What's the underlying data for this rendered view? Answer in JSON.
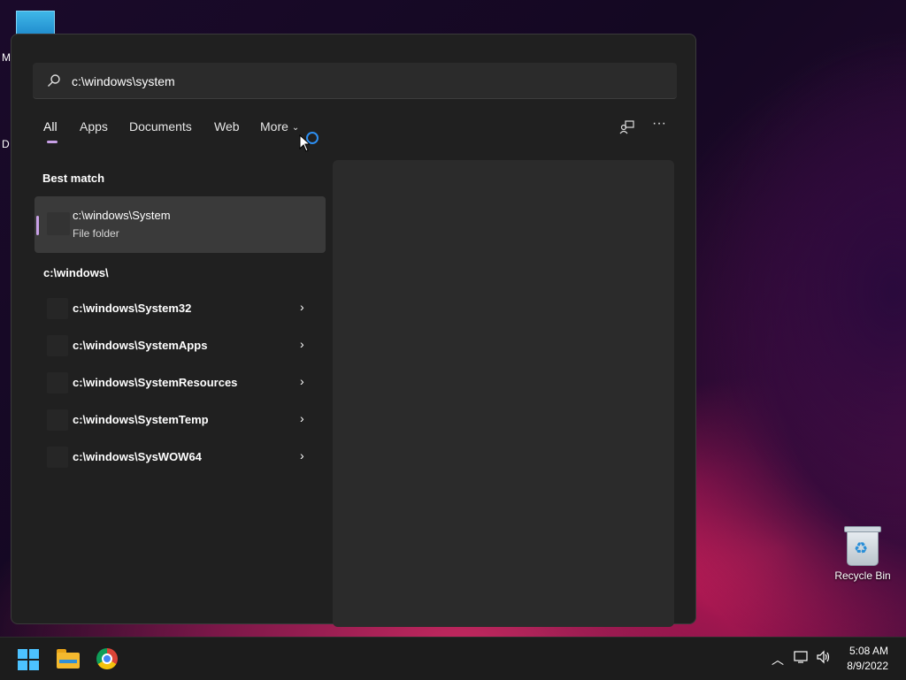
{
  "desktop": {
    "partial_label_1": "M",
    "partial_label_2": "D",
    "recycle_bin_label": "Recycle Bin"
  },
  "search": {
    "query": "c:\\windows\\system",
    "tabs": [
      {
        "label": "All",
        "active": true
      },
      {
        "label": "Apps"
      },
      {
        "label": "Documents"
      },
      {
        "label": "Web"
      },
      {
        "label": "More"
      }
    ],
    "best_match_heading": "Best match",
    "best_match": {
      "title": "c:\\windows\\System",
      "subtitle": "File folder"
    },
    "section_heading": "c:\\windows\\",
    "results": [
      {
        "title": "c:\\windows\\System32"
      },
      {
        "title": "c:\\windows\\SystemApps"
      },
      {
        "title": "c:\\windows\\SystemResources"
      },
      {
        "title": "c:\\windows\\SystemTemp"
      },
      {
        "title": "c:\\windows\\SysWOW64"
      }
    ]
  },
  "taskbar": {
    "time": "5:08 AM",
    "date": "8/9/2022"
  },
  "colors": {
    "accent": "#c8a0e6",
    "panel_bg": "#202020",
    "windows_blue": "#4cc2ff"
  }
}
